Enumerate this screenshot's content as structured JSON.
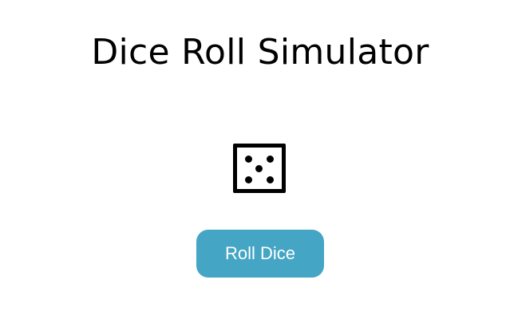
{
  "page": {
    "title": "Dice Roll Simulator"
  },
  "die": {
    "value": 5,
    "icon": "dice-five-icon"
  },
  "controls": {
    "roll_label": "Roll Dice"
  },
  "colors": {
    "button_bg": "#45a5c4",
    "button_text": "#ffffff",
    "die_color": "#000000"
  }
}
